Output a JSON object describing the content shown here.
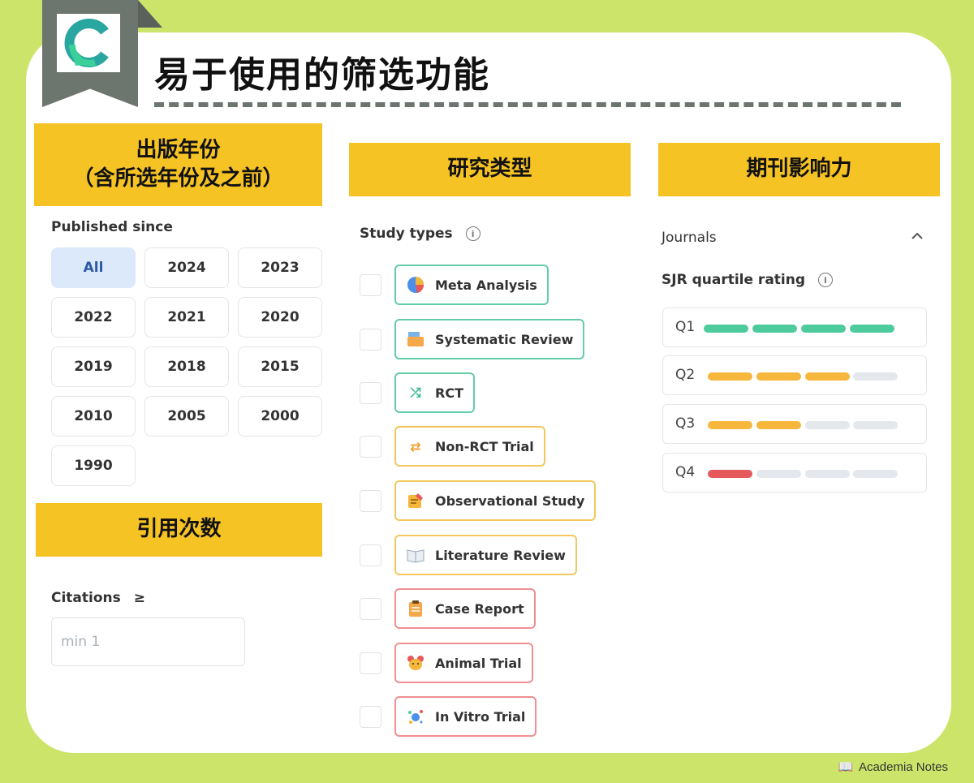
{
  "page": {
    "title": "易于使用的筛选功能"
  },
  "logo": {
    "letter": "C"
  },
  "columns": {
    "year": {
      "header_line1": "出版年份",
      "header_line2": "（含所选年份及之前）"
    },
    "citations": {
      "header": "引用次数"
    },
    "study": {
      "header": "研究类型"
    },
    "journal": {
      "header": "期刊影响力"
    }
  },
  "published": {
    "label": "Published since",
    "years": [
      "All",
      "2024",
      "2023",
      "2022",
      "2021",
      "2020",
      "2019",
      "2018",
      "2015",
      "2010",
      "2005",
      "2000",
      "1990"
    ],
    "selected": "All"
  },
  "citations": {
    "label": "Citations",
    "operator": "≥",
    "placeholder": "min 1"
  },
  "study_types": {
    "label": "Study types",
    "items": [
      {
        "label": "Meta Analysis",
        "color": "green",
        "icon": "pie-chart-icon"
      },
      {
        "label": "Systematic Review",
        "color": "green",
        "icon": "folder-icon"
      },
      {
        "label": "RCT",
        "color": "green",
        "icon": "shuffle-icon"
      },
      {
        "label": "Non-RCT Trial",
        "color": "yellow",
        "icon": "swap-arrows-icon"
      },
      {
        "label": "Observational Study",
        "color": "yellow",
        "icon": "notepad-icon"
      },
      {
        "label": "Literature Review",
        "color": "yellow",
        "icon": "open-book-icon"
      },
      {
        "label": "Case Report",
        "color": "red",
        "icon": "clipboard-icon"
      },
      {
        "label": "Animal Trial",
        "color": "red",
        "icon": "mouse-icon"
      },
      {
        "label": "In Vitro Trial",
        "color": "red",
        "icon": "microbe-icon"
      }
    ]
  },
  "journals": {
    "label": "Journals",
    "sjr_label": "SJR quartile rating",
    "quartiles": [
      {
        "label": "Q1",
        "filled": 4,
        "color": "#4ecb9d"
      },
      {
        "label": "Q2",
        "filled": 3,
        "color": "#f6b73c"
      },
      {
        "label": "Q3",
        "filled": 2,
        "color": "#f6b73c"
      },
      {
        "label": "Q4",
        "filled": 1,
        "color": "#e5585c"
      }
    ]
  },
  "footer": {
    "brand": "Academia Notes"
  }
}
